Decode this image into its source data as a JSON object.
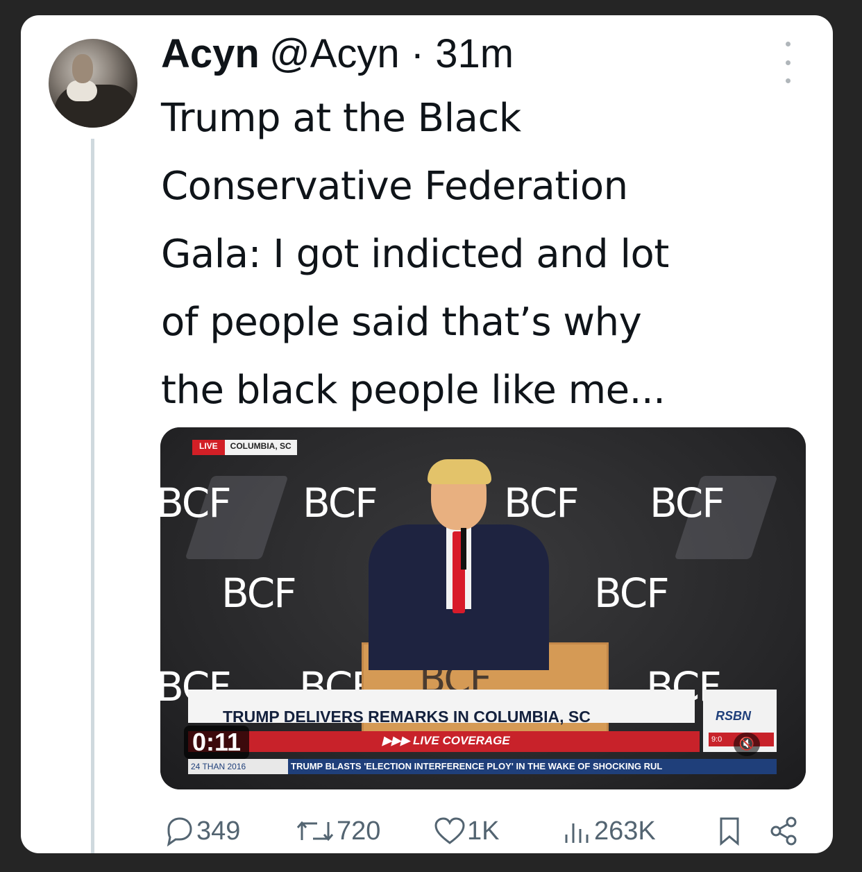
{
  "tweet": {
    "display_name": "Acyn",
    "handle_time": "@Acyn · 31m",
    "text_lines": [
      "Trump at the Black",
      "Conservative Federation",
      "Gala: I got indicted and lot",
      "of people said that’s why",
      "the black people like me..."
    ]
  },
  "media": {
    "live_label": "LIVE",
    "location": "COLUMBIA, SC",
    "logo_text": "BCF",
    "headline": "TRUMP DELIVERS REMARKS IN COLUMBIA, SC",
    "live_coverage": "▶▶▶ LIVE COVERAGE",
    "ticker_left": "24 THAN 2016",
    "ticker_text": "TRUMP BLASTS 'ELECTION INTERFERENCE PLOY' IN THE WAKE OF SHOCKING RUL",
    "network": "RSBN",
    "clock": "9:0",
    "video_time": "0:11"
  },
  "actions": {
    "replies": "349",
    "reposts": "720",
    "likes": "1K",
    "views": "263K"
  },
  "icons": [
    "reply-icon",
    "repost-icon",
    "like-icon",
    "views-icon",
    "bookmark-icon",
    "share-icon",
    "more-icon",
    "mute-icon"
  ]
}
